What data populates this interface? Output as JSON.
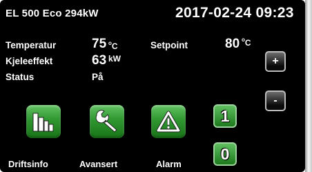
{
  "header": {
    "model": "EL 500 Eco 294kW",
    "datetime": "2017-02-24  09:23"
  },
  "status": {
    "temperature_label": "Temperatur",
    "temperature_value": "75",
    "temperature_unit_sup": "o",
    "temperature_unit": "C",
    "power_label": "Kjeleeffekt",
    "power_value": "63",
    "power_unit": "kW",
    "status_label": "Status",
    "status_value": "På",
    "setpoint_label": "Setpoint",
    "setpoint_value": "80",
    "setpoint_unit_sup": "o",
    "setpoint_unit": "C"
  },
  "controls": {
    "plus": "+",
    "minus": "-",
    "on": "1",
    "off": "0"
  },
  "buttons": {
    "driftsinfo": "Driftsinfo",
    "avansert": "Avansert",
    "alarm": "Alarm"
  },
  "colors": {
    "button_green": "#2f972f",
    "background": "#000000",
    "text": "#ffffff"
  },
  "icons": {
    "driftsinfo": "bar-chart-icon",
    "avansert": "wrench-icon",
    "alarm": "warning-triangle-icon"
  }
}
